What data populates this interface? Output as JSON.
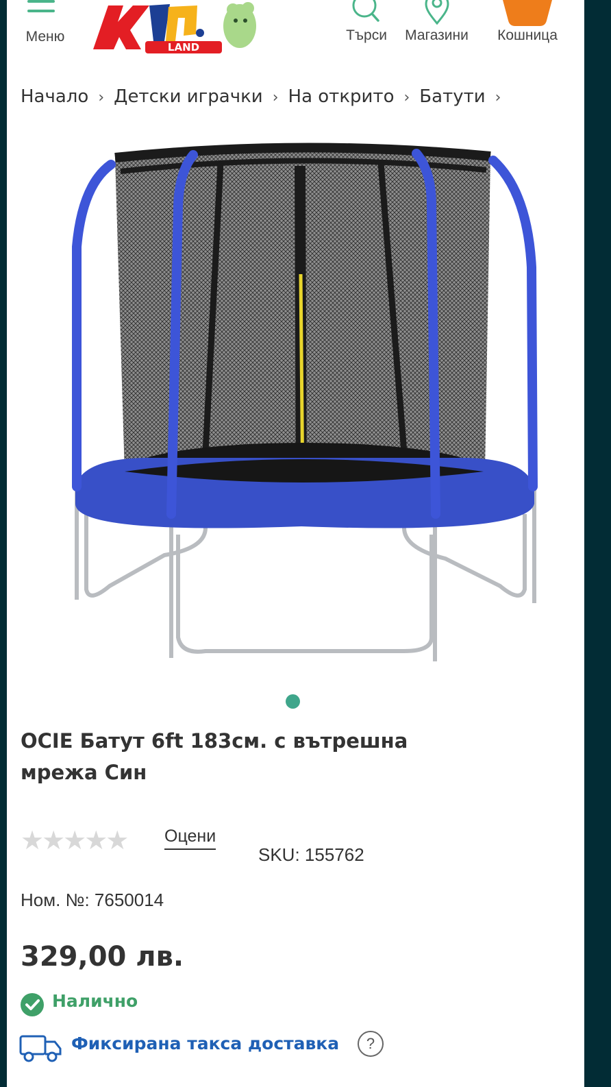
{
  "header": {
    "menu_label": "Меню",
    "logo_text": "Хип.",
    "logo_sub": "LAND",
    "search_label": "Търси",
    "stores_label": "Магазини",
    "cart_label": "Кошница"
  },
  "breadcrumb": [
    "Начало",
    "Детски играчки",
    "На открито",
    "Батути"
  ],
  "product": {
    "title": "OCIE Батут 6ft 183см. с вътрешна мрежа Син",
    "rating_stars": 0,
    "rate_link": "Оцени",
    "sku": "SKU: 155762",
    "item_number": "Ном. №: 7650014",
    "price": "329,00 лв.",
    "availability": "Налично",
    "delivery": "Фиксирана такса доставка",
    "help_icon": "?"
  },
  "colors": {
    "accent_green": "#3fa68b",
    "price_text": "#333333",
    "delivery_blue": "#1f60b5",
    "cart_orange": "#ee7d1b",
    "background_dark": "#022c35"
  },
  "carousel": {
    "current": 1,
    "total": 1
  }
}
